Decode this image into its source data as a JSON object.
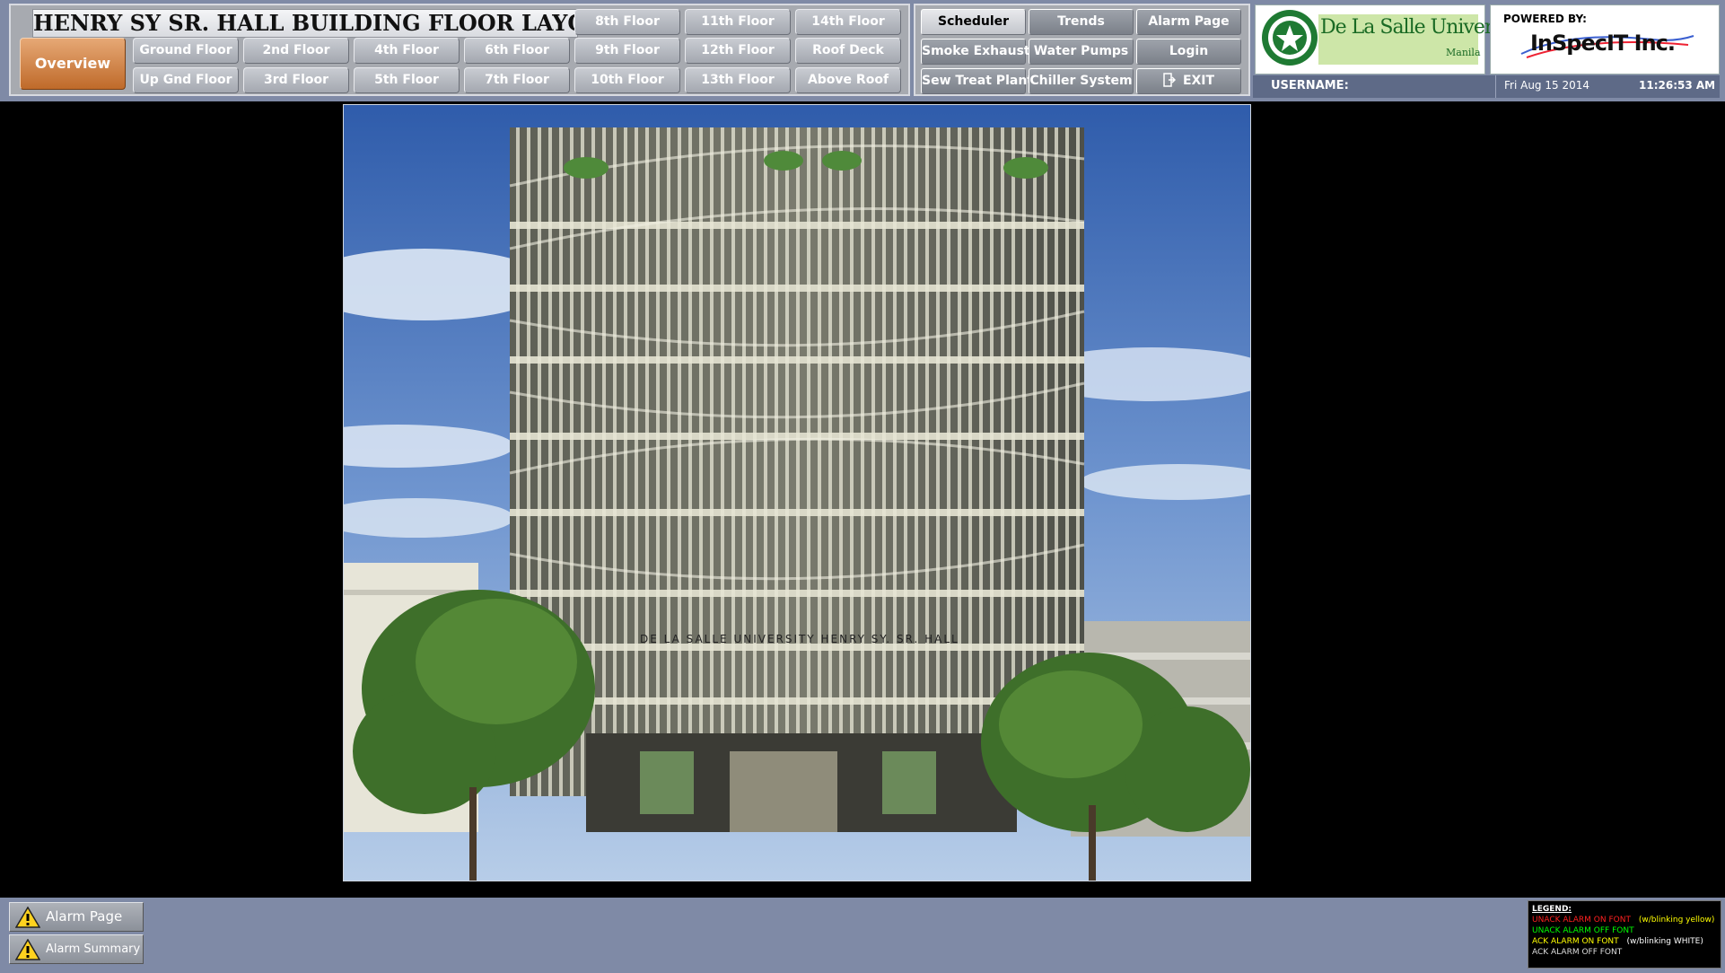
{
  "header": {
    "title": "HENRY SY SR. HALL BUILDING FLOOR LAYOUT",
    "overview_label": "Overview",
    "floors": {
      "ground": "Ground Floor",
      "up_gnd": "Up Gnd Floor",
      "f2": "2nd Floor",
      "f3": "3rd Floor",
      "f4": "4th Floor",
      "f5": "5th Floor",
      "f6": "6th Floor",
      "f7": "7th Floor",
      "f8": "8th Floor",
      "f9": "9th Floor",
      "f10": "10th Floor",
      "f11": "11th Floor",
      "f12": "12th Floor",
      "f13": "13th Floor",
      "f14": "14th Floor",
      "roof_deck": "Roof Deck",
      "above_roof": "Above Roof"
    }
  },
  "systems": {
    "scheduler": "Scheduler",
    "trends": "Trends",
    "alarm_page": "Alarm Page",
    "smoke_exhaust": "Smoke Exhaust",
    "water_pumps": "Water Pumps",
    "login": "Login",
    "sew_treat_plant": "Sew Treat Plant",
    "chiller_system": "Chiller System",
    "exit": "EXIT"
  },
  "logos": {
    "university": "De La Salle University",
    "university_sub": "Manila",
    "powered_by": "POWERED BY:",
    "company": "InSpecIT Inc."
  },
  "status": {
    "username_label": "USERNAME:",
    "username_value": "",
    "date": "Fri Aug 15 2014",
    "time": "11:26:53 AM"
  },
  "building": {
    "sign": "DE LA SALLE UNIVERSITY HENRY SY. SR. HALL"
  },
  "footer": {
    "alarm_page": "Alarm Page",
    "alarm_summary": "Alarm Summary"
  },
  "legend": {
    "title": "LEGEND:",
    "items": [
      {
        "text": "UNACK ALARM ON FONT",
        "note": "(w/blinking yellow)",
        "color": "#ff2020",
        "note_color": "#ffff00"
      },
      {
        "text": "UNACK ALARM OFF FONT",
        "note": "",
        "color": "#00ff00",
        "note_color": ""
      },
      {
        "text": "ACK ALARM ON FONT",
        "note": "(w/blinking WHITE)",
        "color": "#ffff00",
        "note_color": "#ffffff"
      },
      {
        "text": "ACK ALARM OFF FONT",
        "note": "",
        "color": "#dddddd",
        "note_color": ""
      }
    ]
  },
  "colors": {
    "bar": "#7f8aa6",
    "active_button": "#d9894a",
    "university_green": "#1a7a2a"
  }
}
